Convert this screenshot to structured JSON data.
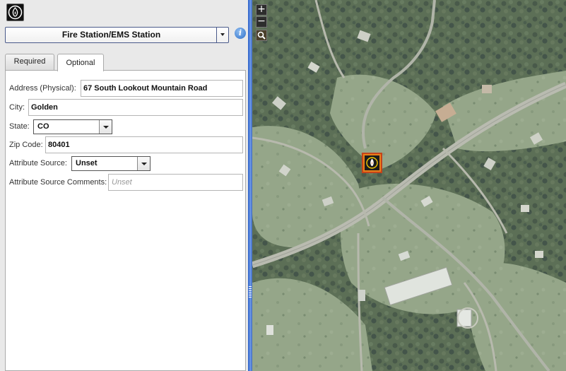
{
  "feature_type": {
    "selected": "Fire Station/EMS Station"
  },
  "tabs": [
    {
      "label": "Required",
      "active": false
    },
    {
      "label": "Optional",
      "active": true
    }
  ],
  "form": {
    "address": {
      "label": "Address (Physical):",
      "value": "67 South Lookout Mountain Road"
    },
    "city": {
      "label": "City:",
      "value": "Golden"
    },
    "state": {
      "label": "State:",
      "value": "CO"
    },
    "zip": {
      "label": "Zip Code:",
      "value": "80401"
    },
    "attribute_source": {
      "label": "Attribute Source:",
      "value": "Unset"
    },
    "attribute_source_comments": {
      "label": "Attribute Source Comments:",
      "placeholder": "Unset"
    }
  },
  "map": {
    "zoom_in_symbol": "+",
    "zoom_out_symbol": "−",
    "marker_icon": "fire-station-icon",
    "marker_color": "#e8801a"
  },
  "icons": {
    "app_logo": "fire-station-logo-icon",
    "info": "info-icon",
    "magnifier": "magnifier-icon"
  },
  "colors": {
    "splitter": "#3a6fd8",
    "accent_border": "#4a5a8a"
  }
}
